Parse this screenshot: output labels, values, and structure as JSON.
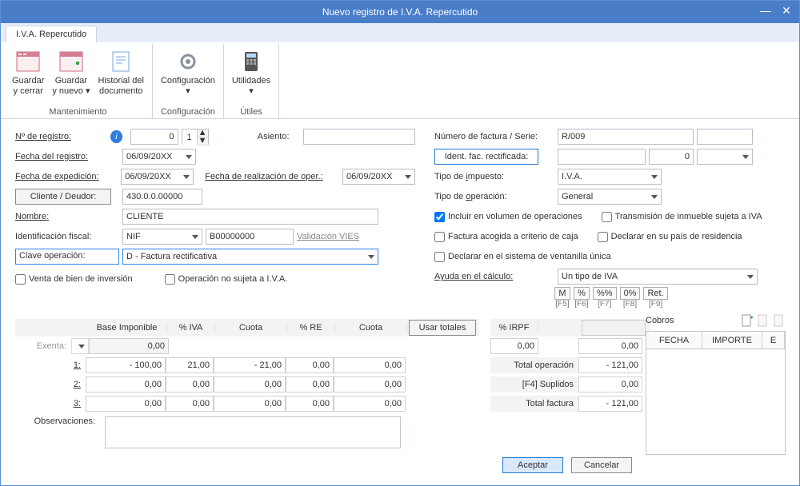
{
  "window": {
    "title": "Nuevo registro de I.V.A. Repercutido"
  },
  "tab": {
    "label": "I.V.A. Repercutido"
  },
  "ribbon": {
    "groups": [
      {
        "label": "Mantenimiento",
        "items": [
          {
            "line1": "Guardar",
            "line2": "y cerrar"
          },
          {
            "line1": "Guardar",
            "line2": "y nuevo ▾"
          },
          {
            "line1": "Historial del",
            "line2": "documento"
          }
        ]
      },
      {
        "label": "Configuración",
        "items": [
          {
            "line1": "Configuración",
            "line2": "▾"
          }
        ]
      },
      {
        "label": "Útiles",
        "items": [
          {
            "line1": "Utilidades",
            "line2": "▾"
          }
        ]
      }
    ]
  },
  "left": {
    "num_registro_lbl": "Nº de registro:",
    "num_registro_val": "0",
    "fecha_registro_lbl": "Fecha del registro:",
    "fecha_registro_val": "06/09/20XX",
    "fecha_exped_lbl": "Fecha de expedición:",
    "fecha_exped_val": "06/09/20XX",
    "fecha_realiz_lbl": "Fecha de realización de oper.:",
    "fecha_realiz_val": "06/09/20XX",
    "cliente_btn": "Cliente / Deudor:",
    "cliente_val": "430.0.0.00000",
    "nombre_lbl": "Nombre:",
    "nombre_val": "CLIENTE",
    "idfiscal_lbl": "Identificación fiscal:",
    "idfiscal_type": "NIF",
    "idfiscal_num": "B00000000",
    "validacion": "Validación VIES",
    "clave_lbl": "Clave operación:",
    "clave_val": "D - Factura rectificativa",
    "asiento_lbl": "Asiento:",
    "chk_venta": "Venta de bien de inversión",
    "chk_nosujeta": "Operación no sujeta a I.V.A."
  },
  "right": {
    "numfac_lbl": "Número de factura / Serie:",
    "numfac_val": "R/009",
    "ident_btn": "Ident. fac. rectificada:",
    "ident_spin": "0",
    "tipo_imp_lbl": "Tipo de impuesto:",
    "tipo_imp_val": "I.V.A.",
    "tipo_op_lbl": "Tipo de operación:",
    "tipo_op_val": "General",
    "chk_incluir": "Incluir en volumen de operaciones",
    "chk_transm": "Transmisión de inmueble sujeta a IVA",
    "chk_criterio": "Factura acogida a criterio de caja",
    "chk_declarar": "Declarar en su país de residencia",
    "chk_ventanilla": "Declarar en el sistema de ventanilla única",
    "ayuda_lbl": "Ayuda en el cálculo:",
    "ayuda_val": "Un tipo de IVA",
    "chips": [
      "M",
      "%",
      "%%",
      "0%",
      "Ret."
    ],
    "chiplbls": [
      "[F5]",
      "[F6]",
      "[F7]",
      "[F8]",
      "[F9]"
    ]
  },
  "grid": {
    "headers": {
      "base": "Base Imponible",
      "piva": "% IVA",
      "cuota": "Cuota",
      "pre": "% RE",
      "cuota2": "Cuota",
      "usar": "Usar totales",
      "pirpf": "% IRPF"
    },
    "rows": [
      {
        "lbl": "Exenta:",
        "v": [
          "0,00"
        ]
      },
      {
        "lbl": "1:",
        "v": [
          "- 100,00",
          "21,00",
          "- 21,00",
          "0,00",
          "0,00"
        ]
      },
      {
        "lbl": "2:",
        "v": [
          "0,00",
          "0,00",
          "0,00",
          "0,00",
          "0,00"
        ]
      },
      {
        "lbl": "3:",
        "v": [
          "0,00",
          "0,00",
          "0,00",
          "0,00",
          "0,00"
        ]
      }
    ],
    "irpf": "0,00",
    "irpf2": "0,00",
    "totals": [
      {
        "lbl": "Total operación",
        "val": "- 121,00"
      },
      {
        "lbl": "[F4] Suplidos",
        "val": "0,00"
      },
      {
        "lbl": "Total factura",
        "val": "- 121,00"
      }
    ],
    "obs_lbl": "Observaciones:"
  },
  "cobros": {
    "title": "Cobros",
    "cols": [
      "FECHA",
      "IMPORTE",
      "E"
    ]
  },
  "footer": {
    "ok": "Aceptar",
    "cancel": "Cancelar"
  }
}
